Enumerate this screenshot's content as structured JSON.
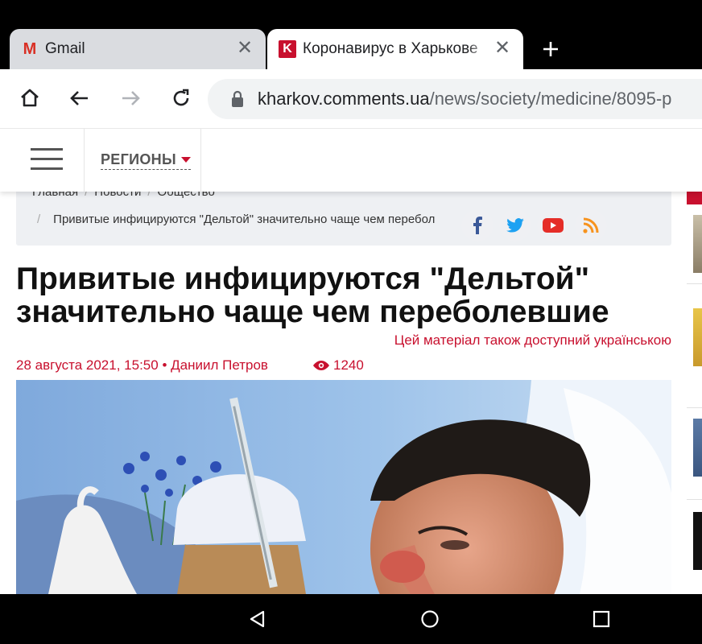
{
  "browser": {
    "tabs": [
      {
        "title": "Gmail",
        "favicon": "gmail-icon",
        "active": false
      },
      {
        "title": "Коронавирус в Харькове",
        "favicon": "kharkov-comments-icon",
        "active": true
      }
    ],
    "new_tab_icon": "plus-icon",
    "toolbar": {
      "home_icon": "home-icon",
      "back_icon": "arrow-back-icon",
      "forward_icon": "arrow-forward-icon",
      "reload_icon": "reload-icon"
    },
    "url": {
      "host": "kharkov.comments.ua",
      "path": "/news/society/medicine/8095-p"
    }
  },
  "site": {
    "regions_label": "РЕГИОНЫ",
    "brand_color": "#c8102e"
  },
  "breadcrumb": {
    "items": [
      "Главная",
      "Новости",
      "Общество"
    ],
    "separator": "/",
    "current": "Привитые инфицируются \"Дельтой\" значительно чаще чем перебол"
  },
  "social": [
    "facebook-icon",
    "twitter-icon",
    "youtube-icon",
    "rss-icon"
  ],
  "article": {
    "title": "Привитые инфицируются \"Дельтой\" значительно чаще чем переболевшие",
    "also_available": "Цей матеріал також доступний українською",
    "date": "28 августа 2021, 15:50",
    "bullet": "•",
    "author": "Даниил Петров",
    "views": "1240"
  },
  "system_nav": [
    "back-triangle-icon",
    "home-circle-icon",
    "recents-square-icon"
  ]
}
